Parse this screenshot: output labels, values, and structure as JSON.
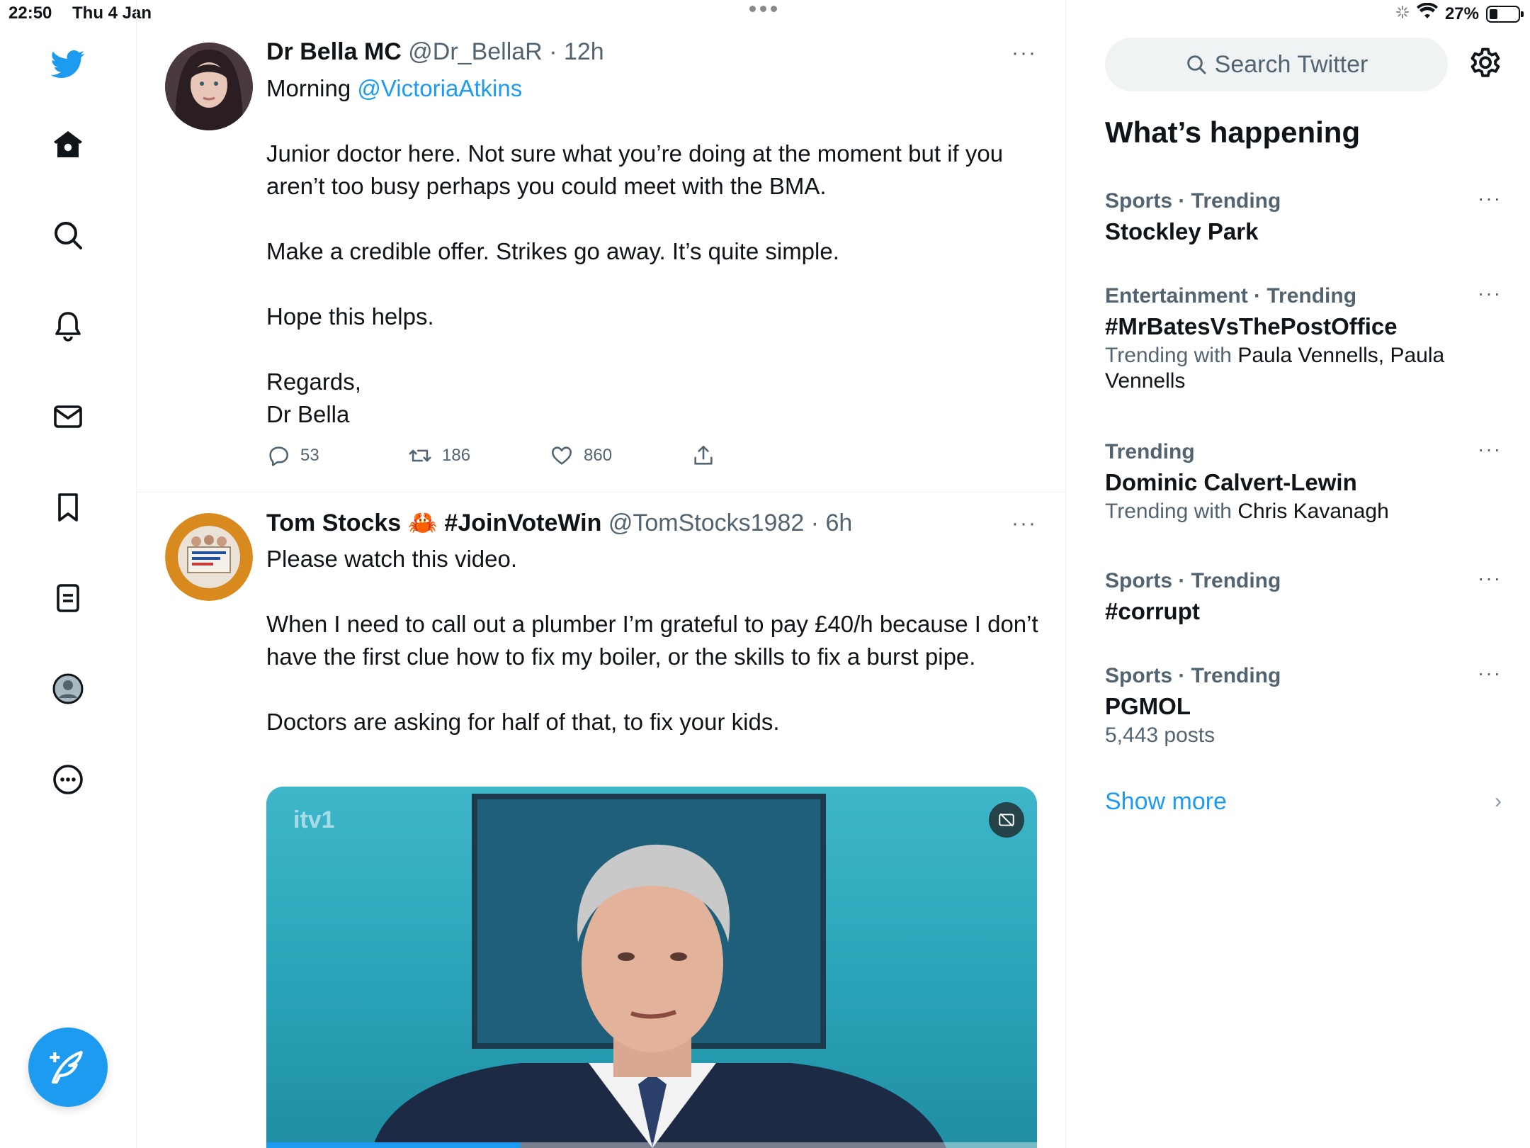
{
  "status_bar": {
    "time": "22:50",
    "date": "Thu 4 Jan",
    "battery": "27%"
  },
  "nav": {
    "items": [
      "twitter-logo",
      "home",
      "explore",
      "notifications",
      "messages",
      "bookmarks",
      "lists",
      "profile",
      "more"
    ],
    "compose_icon": "compose-feather-icon"
  },
  "tweets": [
    {
      "name": "Dr Bella MC",
      "handle": "@Dr_BellaR",
      "sep": "·",
      "time": "12h",
      "more": "···",
      "body": {
        "line1_prefix": "Morning ",
        "mention": "@VictoriaAtkins",
        "para1": "Junior doctor here. Not sure what you’re doing at the moment but if you aren’t too busy perhaps you could meet with the BMA.",
        "para2": "Make a credible offer. Strikes go away. It’s quite simple.",
        "para3": "Hope this helps.",
        "para4a": "Regards,",
        "para4b": "Dr Bella"
      },
      "replies": "53",
      "retweets": "186",
      "likes": "860"
    },
    {
      "name": "Tom Stocks 🦀 #JoinVoteWin",
      "handle": "@TomStocks1982",
      "sep": "·",
      "time": "6h",
      "more": "···",
      "body": {
        "para1": "Please watch this video.",
        "para2": "When I need to call out a plumber I’m grateful to pay £40/h because I don’t have the first clue how to fix my boiler, or the skills to fix a burst pipe.",
        "para3": "Doctors are asking for half of that, to fix your kids."
      },
      "media": {
        "channel": "itv1",
        "progress": 0.33
      }
    }
  ],
  "sidebar": {
    "search_placeholder": "Search Twitter",
    "section_title": "What’s happening",
    "trends": [
      {
        "meta": "Sports · Trending",
        "title": "Stockley Park"
      },
      {
        "meta": "Entertainment · Trending",
        "title": "#MrBatesVsThePostOffice",
        "sub_prefix": "Trending with ",
        "sub_with": "Paula Vennells, Paula",
        "sub_tail": "Vennells"
      },
      {
        "meta": "Trending",
        "title": "Dominic Calvert-Lewin",
        "sub_prefix": "Trending with ",
        "sub_with": "Chris Kavanagh"
      },
      {
        "meta": "Sports · Trending",
        "title": "#corrupt"
      },
      {
        "meta": "Sports · Trending",
        "title": "PGMOL",
        "sub_prefix": "5,443 posts"
      }
    ],
    "trend_more": "···",
    "show_more": "Show more",
    "chevron": "›"
  },
  "colors": {
    "accent": "#1d9bf0",
    "text": "#0f1419",
    "secondary": "#536471",
    "search_bg": "#eff3f4"
  }
}
